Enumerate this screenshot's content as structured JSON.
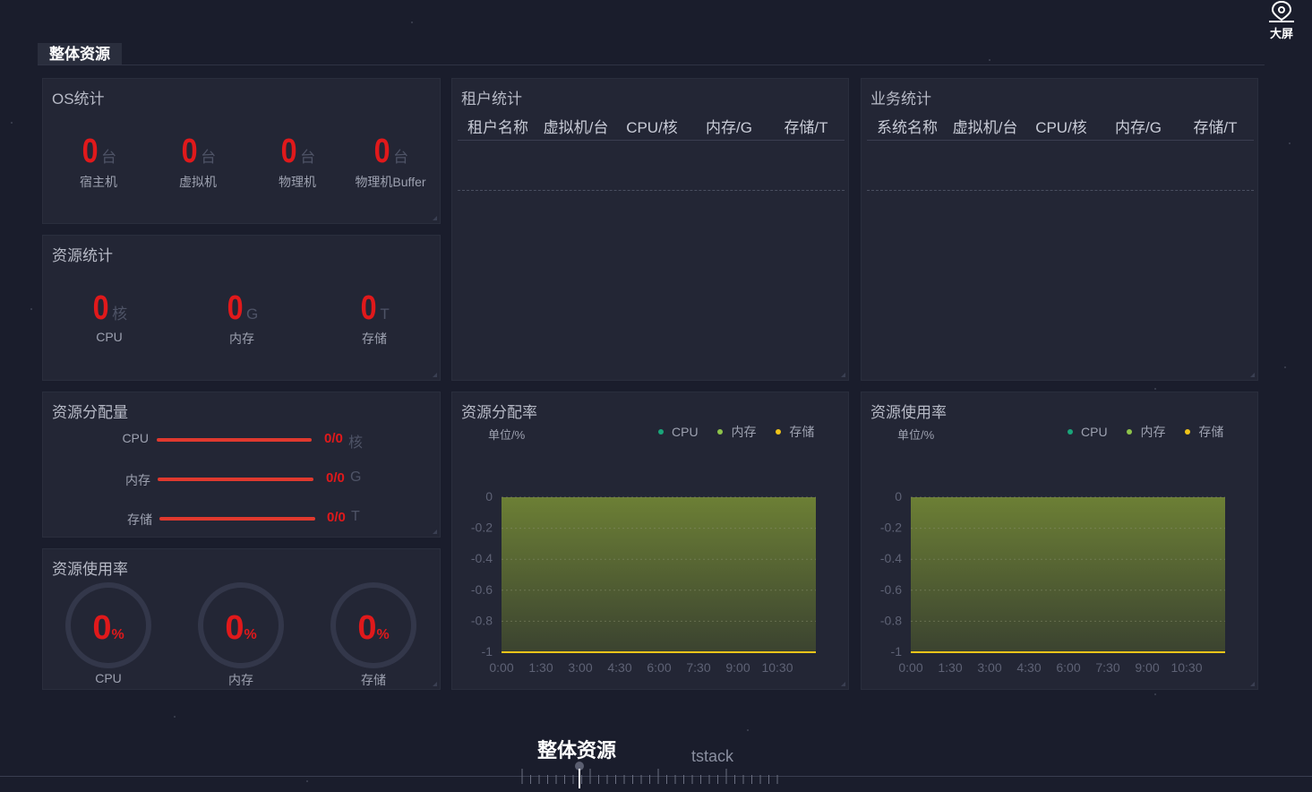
{
  "header": {
    "section_tab": "整体资源",
    "big_screen_label": "大屏"
  },
  "os_stats": {
    "title": "OS统计",
    "items": [
      {
        "value": "0",
        "unit": "台",
        "label": "宿主机"
      },
      {
        "value": "0",
        "unit": "台",
        "label": "虚拟机"
      },
      {
        "value": "0",
        "unit": "台",
        "label": "物理机"
      },
      {
        "value": "0",
        "unit": "台",
        "label": "物理机Buffer"
      }
    ]
  },
  "resource_stats": {
    "title": "资源统计",
    "items": [
      {
        "value": "0",
        "unit": "核",
        "label": "CPU"
      },
      {
        "value": "0",
        "unit": "G",
        "label": "内存"
      },
      {
        "value": "0",
        "unit": "T",
        "label": "存储"
      }
    ]
  },
  "resource_allocation": {
    "title": "资源分配量",
    "rows": [
      {
        "label": "CPU",
        "value": "0/0",
        "unit": "核"
      },
      {
        "label": "内存",
        "value": "0/0",
        "unit": "G"
      },
      {
        "label": "存储",
        "value": "0/0",
        "unit": "T"
      }
    ]
  },
  "resource_usage": {
    "title": "资源使用率",
    "rings": [
      {
        "value": "0",
        "pct": "%",
        "label": "CPU"
      },
      {
        "value": "0",
        "pct": "%",
        "label": "内存"
      },
      {
        "value": "0",
        "pct": "%",
        "label": "存储"
      }
    ]
  },
  "tenant_stats": {
    "title": "租户统计",
    "columns": [
      "租户名称",
      "虚拟机/台",
      "CPU/核",
      "内存/G",
      "存储/T"
    ]
  },
  "business_stats": {
    "title": "业务统计",
    "columns": [
      "系统名称",
      "虚拟机/台",
      "CPU/核",
      "内存/G",
      "存储/T"
    ]
  },
  "alloc_rate_chart": {
    "title": "资源分配率",
    "unit": "单位/%",
    "legend": [
      {
        "name": "CPU",
        "color": "#1aa57a"
      },
      {
        "name": "内存",
        "color": "#8dc34a"
      },
      {
        "name": "存储",
        "color": "#f0c419"
      }
    ]
  },
  "usage_rate_chart": {
    "title": "资源使用率",
    "unit": "单位/%",
    "legend": [
      {
        "name": "CPU",
        "color": "#1aa57a"
      },
      {
        "name": "内存",
        "color": "#8dc34a"
      },
      {
        "name": "存储",
        "color": "#f0c419"
      }
    ]
  },
  "chart_data": [
    {
      "type": "area",
      "x": [
        "0:00",
        "1:30",
        "3:00",
        "4:30",
        "6:00",
        "7:30",
        "9:00",
        "10:30"
      ],
      "ylim": [
        -1,
        0
      ],
      "yticks": [
        "0",
        "-0.2",
        "-0.4",
        "-0.6",
        "-0.8",
        "-1"
      ],
      "series": [
        {
          "name": "存储",
          "values": [
            0,
            0,
            0,
            0,
            0,
            0,
            0,
            0
          ],
          "color": "#f0c419"
        }
      ],
      "grid": true
    },
    {
      "type": "area",
      "x": [
        "0:00",
        "1:30",
        "3:00",
        "4:30",
        "6:00",
        "7:30",
        "9:00",
        "10:30"
      ],
      "ylim": [
        -1,
        0
      ],
      "yticks": [
        "0",
        "-0.2",
        "-0.4",
        "-0.6",
        "-0.8",
        "-1"
      ],
      "series": [
        {
          "name": "存储",
          "values": [
            0,
            0,
            0,
            0,
            0,
            0,
            0,
            0
          ],
          "color": "#f0c419"
        }
      ],
      "grid": true
    }
  ],
  "bottom_nav": {
    "active": "整体资源",
    "next": "tstack"
  }
}
